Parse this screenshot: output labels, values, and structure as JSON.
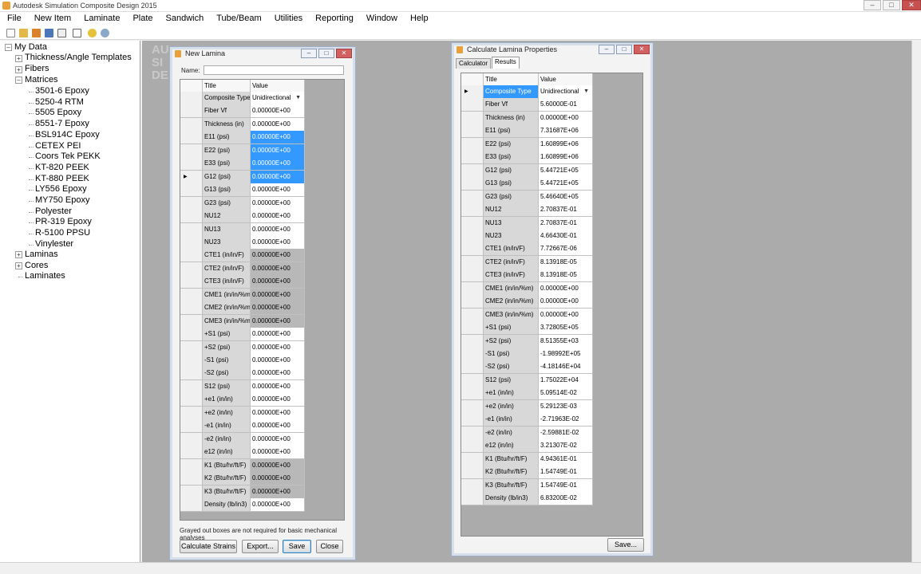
{
  "app": {
    "title": "Autodesk Simulation Composite Design 2015"
  },
  "menu": [
    "File",
    "New Item",
    "Laminate",
    "Plate",
    "Sandwich",
    "Tube/Beam",
    "Utilities",
    "Reporting",
    "Window",
    "Help"
  ],
  "tree": {
    "root": "My Data",
    "thickness": "Thickness/Angle Templates",
    "fibers": "Fibers",
    "matrices": "Matrices",
    "matrix_items": [
      "3501-6 Epoxy",
      "5250-4 RTM",
      "5505 Epoxy",
      "8551-7 Epoxy",
      "BSL914C Epoxy",
      "CETEX PEI",
      "Coors Tek PEKK",
      "KT-820 PEEK",
      "KT-880 PEEK",
      "LY556 Epoxy",
      "MY750 Epoxy",
      "Polyester",
      "PR-319 Epoxy",
      "R-5100 PPSU",
      "Vinylester"
    ],
    "laminas": "Laminas",
    "cores": "Cores",
    "laminates": "Laminates"
  },
  "background_logo": [
    "AU",
    "SI",
    "DE"
  ],
  "new_lamina": {
    "title": "New Lamina",
    "name_label": "Name:",
    "name_value": "",
    "col_title": "Title",
    "col_value": "Value",
    "rows": [
      {
        "title": "Composite Type",
        "value": "Unidirectional",
        "state": "dropdown"
      },
      {
        "title": "Fiber Vf",
        "value": "0.00000E+00",
        "state": "white"
      },
      {
        "title": "Thickness (in)",
        "value": "0.00000E+00",
        "state": "white"
      },
      {
        "title": "E11 (psi)",
        "value": "0.00000E+00",
        "state": "sel"
      },
      {
        "title": "E22 (psi)",
        "value": "0.00000E+00",
        "state": "sel"
      },
      {
        "title": "E33 (psi)",
        "value": "0.00000E+00",
        "state": "sel"
      },
      {
        "title": "G12 (psi)",
        "value": "0.00000E+00",
        "state": "sel"
      },
      {
        "title": "G13 (psi)",
        "value": "0.00000E+00",
        "state": "white"
      },
      {
        "title": "G23 (psi)",
        "value": "0.00000E+00",
        "state": "white"
      },
      {
        "title": "NU12",
        "value": "0.00000E+00",
        "state": "white"
      },
      {
        "title": "NU13",
        "value": "0.00000E+00",
        "state": "white"
      },
      {
        "title": "NU23",
        "value": "0.00000E+00",
        "state": "white"
      },
      {
        "title": "CTE1 (in/in/F)",
        "value": "0.00000E+00",
        "state": "gray"
      },
      {
        "title": "CTE2 (in/in/F)",
        "value": "0.00000E+00",
        "state": "gray"
      },
      {
        "title": "CTE3 (in/in/F)",
        "value": "0.00000E+00",
        "state": "gray"
      },
      {
        "title": "CME1 (in/in/%m)",
        "value": "0.00000E+00",
        "state": "gray"
      },
      {
        "title": "CME2 (in/in/%m)",
        "value": "0.00000E+00",
        "state": "gray"
      },
      {
        "title": "CME3 (in/in/%m)",
        "value": "0.00000E+00",
        "state": "gray"
      },
      {
        "title": "+S1 (psi)",
        "value": "0.00000E+00",
        "state": "white"
      },
      {
        "title": "+S2 (psi)",
        "value": "0.00000E+00",
        "state": "white"
      },
      {
        "title": "-S1 (psi)",
        "value": "0.00000E+00",
        "state": "white"
      },
      {
        "title": "-S2 (psi)",
        "value": "0.00000E+00",
        "state": "white"
      },
      {
        "title": "S12 (psi)",
        "value": "0.00000E+00",
        "state": "white"
      },
      {
        "title": "+e1 (in/in)",
        "value": "0.00000E+00",
        "state": "white"
      },
      {
        "title": "+e2 (in/in)",
        "value": "0.00000E+00",
        "state": "white"
      },
      {
        "title": "-e1 (in/in)",
        "value": "0.00000E+00",
        "state": "white"
      },
      {
        "title": "-e2 (in/in)",
        "value": "0.00000E+00",
        "state": "white"
      },
      {
        "title": "e12 (in/in)",
        "value": "0.00000E+00",
        "state": "white"
      },
      {
        "title": "K1 (Btu/hr/ft/F)",
        "value": "0.00000E+00",
        "state": "gray"
      },
      {
        "title": "K2 (Btu/hr/ft/F)",
        "value": "0.00000E+00",
        "state": "gray"
      },
      {
        "title": "K3 (Btu/hr/ft/F)",
        "value": "0.00000E+00",
        "state": "gray"
      },
      {
        "title": "Density (lb/in3)",
        "value": "0.00000E+00",
        "state": "white"
      }
    ],
    "note": "Grayed out boxes are not required for basic mechanical analyses",
    "buttons": {
      "calculate": "Calculate Strains",
      "export": "Export...",
      "save": "Save",
      "close": "Close"
    }
  },
  "calc_props": {
    "title": "Calculate Lamina Properties",
    "tabs": [
      "Calculator",
      "Results"
    ],
    "col_title": "Title",
    "col_value": "Value",
    "rows": [
      {
        "title": "Composite Type",
        "value": "Unidirectional"
      },
      {
        "title": "Fiber Vf",
        "value": "5.60000E-01"
      },
      {
        "title": "Thickness (in)",
        "value": "0.00000E+00"
      },
      {
        "title": "E11 (psi)",
        "value": "7.31687E+06"
      },
      {
        "title": "E22 (psi)",
        "value": "1.60899E+06"
      },
      {
        "title": "E33 (psi)",
        "value": "1.60899E+06"
      },
      {
        "title": "G12 (psi)",
        "value": "5.44721E+05"
      },
      {
        "title": "G13 (psi)",
        "value": "5.44721E+05"
      },
      {
        "title": "G23 (psi)",
        "value": "5.46640E+05"
      },
      {
        "title": "NU12",
        "value": "2.70837E-01"
      },
      {
        "title": "NU13",
        "value": "2.70837E-01"
      },
      {
        "title": "NU23",
        "value": "4.66430E-01"
      },
      {
        "title": "CTE1 (in/in/F)",
        "value": "7.72667E-06"
      },
      {
        "title": "CTE2 (in/in/F)",
        "value": "8.13918E-05"
      },
      {
        "title": "CTE3 (in/in/F)",
        "value": "8.13918E-05"
      },
      {
        "title": "CME1 (in/in/%m)",
        "value": "0.00000E+00"
      },
      {
        "title": "CME2 (in/in/%m)",
        "value": "0.00000E+00"
      },
      {
        "title": "CME3 (in/in/%m)",
        "value": "0.00000E+00"
      },
      {
        "title": "+S1 (psi)",
        "value": "3.72805E+05"
      },
      {
        "title": "+S2 (psi)",
        "value": "8.51355E+03"
      },
      {
        "title": "-S1 (psi)",
        "value": "-1.98992E+05"
      },
      {
        "title": "-S2 (psi)",
        "value": "-4.18146E+04"
      },
      {
        "title": "S12 (psi)",
        "value": "1.75022E+04"
      },
      {
        "title": "+e1 (in/in)",
        "value": "5.09514E-02"
      },
      {
        "title": "+e2 (in/in)",
        "value": "5.29123E-03"
      },
      {
        "title": "-e1 (in/in)",
        "value": "-2.71963E-02"
      },
      {
        "title": "-e2 (in/in)",
        "value": "-2.59881E-02"
      },
      {
        "title": "e12 (in/in)",
        "value": "3.21307E-02"
      },
      {
        "title": "K1 (Btu/hr/ft/F)",
        "value": "4.94361E-01"
      },
      {
        "title": "K2 (Btu/hr/ft/F)",
        "value": "1.54749E-01"
      },
      {
        "title": "K3 (Btu/hr/ft/F)",
        "value": "1.54749E-01"
      },
      {
        "title": "Density (lb/in3)",
        "value": "6.83200E-02"
      }
    ],
    "save": "Save..."
  },
  "colors": {
    "selection": "#3399ff",
    "mdi_background": "#ababab",
    "gray_cell": "#b8b8b8"
  }
}
